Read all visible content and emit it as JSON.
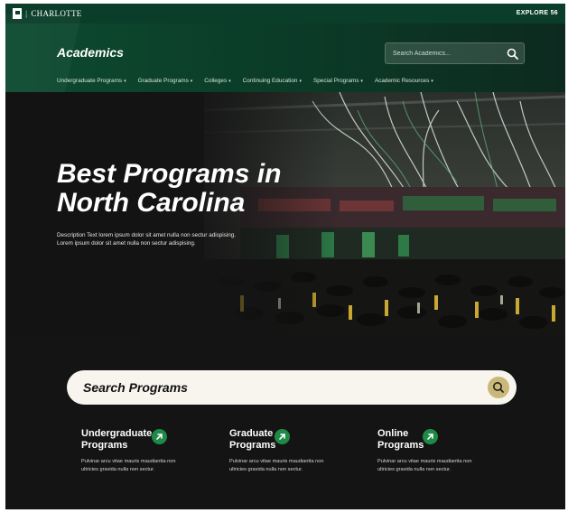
{
  "utility": {
    "logo_text": "CHARLOTTE",
    "explore_label": "EXPLORE",
    "explore_suffix": "56"
  },
  "header": {
    "title": "Academics",
    "search_placeholder": "Search Academics...",
    "nav": [
      {
        "label": "Undergraduate Programs"
      },
      {
        "label": "Graduate Programs"
      },
      {
        "label": "Colleges"
      },
      {
        "label": "Continuing Education"
      },
      {
        "label": "Special Programs"
      },
      {
        "label": "Academic Resources"
      }
    ]
  },
  "hero": {
    "title_line1": "Best Programs in",
    "title_line2": "North Carolina",
    "description_line1": "Description Text lorem ipsum dolor sit amet nulla non sectur adispising.",
    "description_line2": "Lorem ipsum dolor sit amet nulla non sectur adispising."
  },
  "program_search": {
    "placeholder": "Search Programs"
  },
  "cards": [
    {
      "title_line1": "Undergraduate",
      "title_line2": "Programs",
      "desc_line1": "Pulvinar arcu vitae mauris maudiantta non",
      "desc_line2": "ultricies gravida nulla non sectur."
    },
    {
      "title_line1": "Graduate",
      "title_line2": "Programs",
      "desc_line1": "Pulvinar arcu vitae mauris maudiantta non",
      "desc_line2": "ultricies gravida nulla non sectur."
    },
    {
      "title_line1": "Online",
      "title_line2": "Programs",
      "desc_line1": "Pulvinar arcu vitae mauris maudiantta non",
      "desc_line2": "ultricies gravida nulla non sectur."
    }
  ],
  "colors": {
    "brand_green": "#0b3a27",
    "accent_green": "#1e8a47",
    "gold": "#c9b878",
    "background": "#141414"
  },
  "icons": {
    "search": "search-icon",
    "caret": "chevron-down-icon",
    "arrow": "arrow-up-right-icon"
  }
}
